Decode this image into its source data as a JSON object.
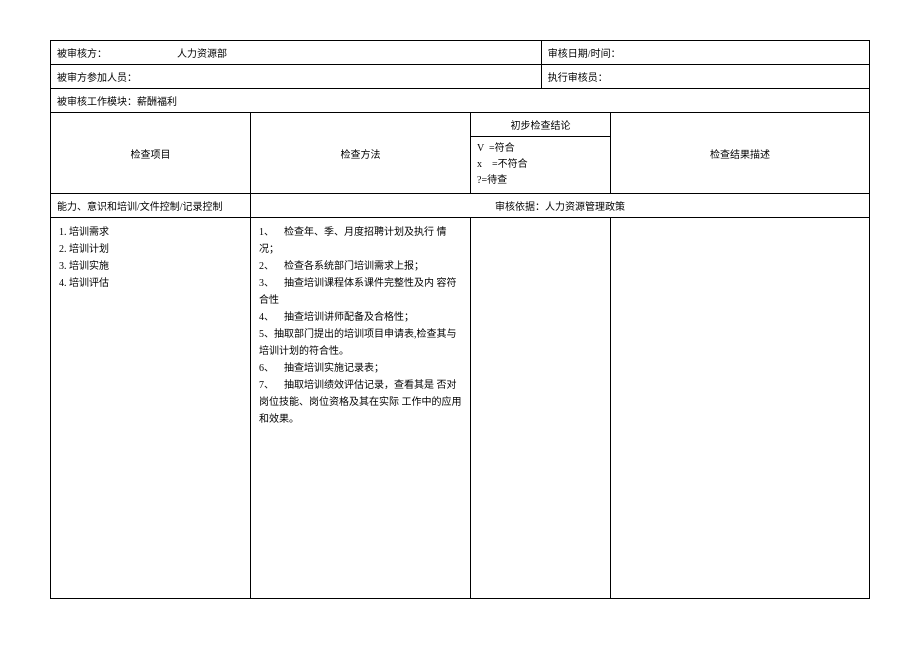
{
  "header": {
    "auditee_label": "被审核方：",
    "auditee_value": "人力资源部",
    "date_label": "审核日期/时间：",
    "participants_label": "被审方参加人员：",
    "auditor_label": "执行审核员：",
    "module_label": "被审核工作模块：",
    "module_value": "薪酬福利"
  },
  "columns": {
    "item": "检查项目",
    "method": "检查方法",
    "prelim_title": "初步检查结论",
    "prelim_legend": "V  =符合\nx    =不符合\n?=待查",
    "result": "检查结果描述"
  },
  "section": {
    "left": "能力、意识和培训/文件控制/记录控制",
    "right": "审核依据：人力资源管理政策"
  },
  "body": {
    "items": "1. 培训需求\n2. 培训计划\n3. 培训实施\n4. 培训评估",
    "methods": "1、    检查年、季、月度招聘计划及执行 情况；\n2、    检查各系统部门培训需求上报；\n3、    抽查培训课程体系课件完整性及内 容符合性\n4、    抽查培训讲师配备及合格性；\n5、抽取部门提出的培训项目申请表,检查其与培训计划的符合性。\n6、    抽查培训实施记录表；\n7、    抽取培训绩效评估记录，查看其是 否对岗位技能、岗位资格及其在实际 工作中的应用和效果。",
    "prelim": "",
    "result": ""
  }
}
